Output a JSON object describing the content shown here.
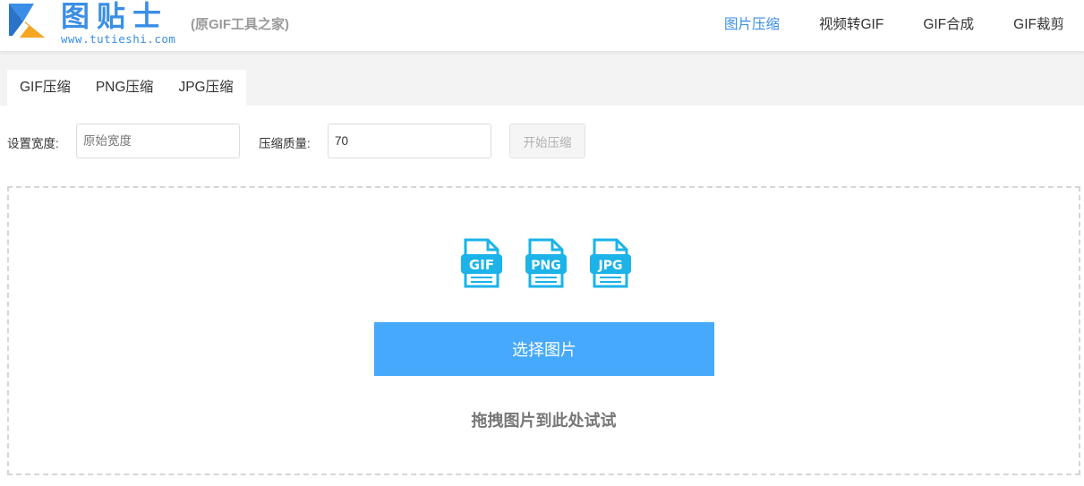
{
  "header": {
    "logo_title": "图贴士",
    "logo_url": "www.tutieshi.com",
    "tagline": "(原GIF工具之家)",
    "nav": [
      {
        "label": "图片压缩",
        "active": true
      },
      {
        "label": "视频转GIF",
        "active": false
      },
      {
        "label": "GIF合成",
        "active": false
      },
      {
        "label": "GIF裁剪",
        "active": false
      }
    ]
  },
  "tabs": [
    {
      "label": "GIF压缩"
    },
    {
      "label": "PNG压缩"
    },
    {
      "label": "JPG压缩"
    }
  ],
  "form": {
    "width_label": "设置宽度:",
    "width_placeholder": "原始宽度",
    "width_value": "",
    "quality_label": "压缩质量:",
    "quality_value": "70",
    "start_button": "开始压缩"
  },
  "dropzone": {
    "file_types": [
      "GIF",
      "PNG",
      "JPG"
    ],
    "select_button": "选择图片",
    "hint": "拖拽图片到此处试试"
  },
  "colors": {
    "accent": "#3a8ee6",
    "button": "#46a9fb",
    "icon": "#1bb3e8",
    "logo_orange": "#f5a623"
  }
}
